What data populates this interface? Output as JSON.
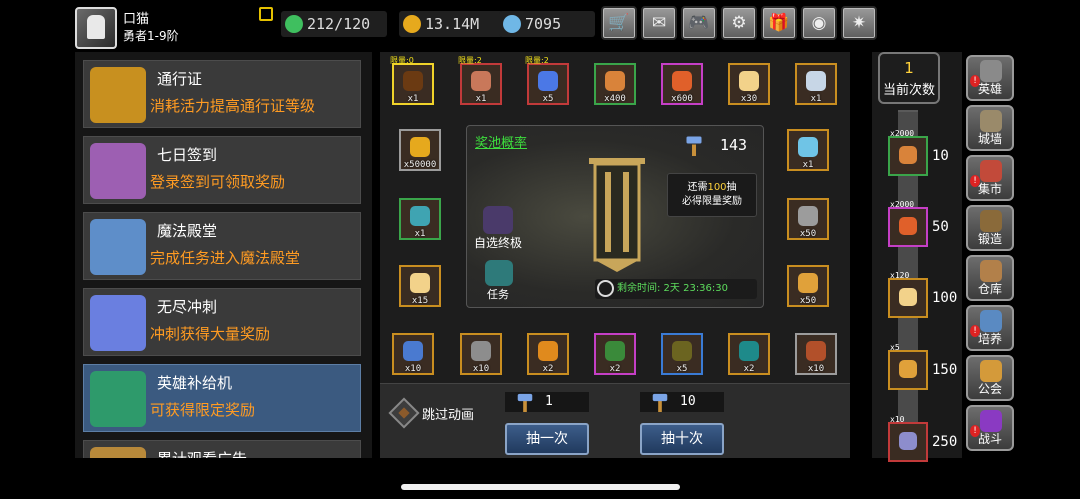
{
  "player": {
    "name": "口猫",
    "rank": "勇者1-9阶"
  },
  "resources": [
    {
      "name": "stamina",
      "icon": "lightning-icon",
      "value": "212/120",
      "color": "#3fbf5f"
    },
    {
      "name": "gold",
      "icon": "gold-coin-icon",
      "value": "13.14M",
      "color": "#e6a91d"
    },
    {
      "name": "diamond",
      "icon": "diamond-icon",
      "value": "7095",
      "color": "#6fb7e6"
    }
  ],
  "top_buttons": [
    {
      "name": "shop-button",
      "icon": "cart-icon",
      "glyph": "🛒"
    },
    {
      "name": "mail-button",
      "icon": "mail-icon",
      "glyph": "✉"
    },
    {
      "name": "gamepad-button",
      "icon": "gamepad-icon",
      "glyph": "🎮"
    },
    {
      "name": "settings-button",
      "icon": "gear-icon",
      "glyph": "⚙"
    },
    {
      "name": "gift-button",
      "icon": "gift-icon",
      "glyph": "🎁"
    },
    {
      "name": "color-wheel-button",
      "icon": "color-wheel-icon",
      "glyph": "◉"
    },
    {
      "name": "effects-button",
      "icon": "sparkle-icon",
      "glyph": "✷"
    }
  ],
  "left_menu": [
    {
      "title": "通行证",
      "desc": "消耗活力提高通行证等级",
      "icon": "golden-chalice-icon",
      "color": "#c8901f"
    },
    {
      "title": "七日签到",
      "desc": "登录签到可领取奖励",
      "icon": "treasure-chest-icon",
      "color": "#9d5fb2"
    },
    {
      "title": "魔法殿堂",
      "desc": "完成任务进入魔法殿堂",
      "icon": "ice-crystal-icon",
      "color": "#5e8ec9"
    },
    {
      "title": "无尽冲刺",
      "desc": "冲刺获得大量奖励",
      "icon": "blue-flame-icon",
      "color": "#6a7fe0"
    },
    {
      "title": "英雄补给机",
      "desc": "可获得限定奖励",
      "icon": "green-machine-icon",
      "color": "#2e9a6b"
    },
    {
      "title": "累计观看广告",
      "desc": "",
      "icon": "tv-icon",
      "color": "#b8893a"
    }
  ],
  "prize_pool": {
    "title": "奖池概率",
    "hammer_count": "143",
    "tip_prefix": "还需",
    "tip_number": "100",
    "tip_suffix": "抽",
    "tip_line2": "必得限量奖励",
    "boss_label": "自选终极",
    "task_label": "任务",
    "timer_text": "剩余时间: 2天 23:36:30"
  },
  "grid_items": [
    {
      "name": "totem",
      "count": "x1",
      "limit": "限量:0",
      "border": "b-yellow",
      "color": "#6b3a12"
    },
    {
      "name": "scroll",
      "count": "x1",
      "limit": "限量:2",
      "border": "b-red",
      "color": "#c9785a"
    },
    {
      "name": "blue-star",
      "count": "x5",
      "limit": "限量:2",
      "border": "b-red",
      "color": "#4b78e6"
    },
    {
      "name": "bone",
      "count": "x400",
      "limit": "",
      "border": "b-green",
      "color": "#d9833a"
    },
    {
      "name": "flame-ore",
      "count": "x600",
      "limit": "",
      "border": "b-pink",
      "color": "#e0602a"
    },
    {
      "name": "egg",
      "count": "x30",
      "limit": "",
      "border": "b-gold",
      "color": "#f2d28a"
    },
    {
      "name": "feather",
      "count": "x1",
      "limit": "",
      "border": "b-gold",
      "color": "#c7d6e6"
    },
    {
      "name": "gold-coin",
      "count": "x50000",
      "limit": "",
      "border": "b-gray",
      "color": "#e6a91d"
    },
    {
      "name": "sapphire",
      "count": "x1",
      "limit": "",
      "border": "b-gold",
      "color": "#6fc4e6"
    },
    {
      "name": "chest",
      "count": "x1",
      "limit": "",
      "border": "b-green",
      "color": "#3fa4b2"
    },
    {
      "name": "hammer",
      "count": "x50",
      "limit": "",
      "border": "b-gold",
      "color": "#9c9c9c"
    },
    {
      "name": "golden-egg",
      "count": "x15",
      "limit": "",
      "border": "b-gold",
      "color": "#f2d28a"
    },
    {
      "name": "wand",
      "count": "x50",
      "limit": "",
      "border": "b-gold",
      "color": "#e0a13a"
    },
    {
      "name": "blue-ore",
      "count": "x10",
      "limit": "",
      "border": "b-gold",
      "color": "#4a7ad0"
    },
    {
      "name": "war-hammer",
      "count": "x10",
      "limit": "",
      "border": "b-gold",
      "color": "#8d8d8d"
    },
    {
      "name": "orange-gem",
      "count": "x2",
      "limit": "",
      "border": "b-gold",
      "color": "#e08a1d"
    },
    {
      "name": "green-rune",
      "count": "x2",
      "limit": "",
      "border": "b-pink",
      "color": "#3a8a3a"
    },
    {
      "name": "dark-rune",
      "count": "x5",
      "limit": "",
      "border": "b-blue",
      "color": "#6b6420"
    },
    {
      "name": "teal-book",
      "count": "x2",
      "limit": "",
      "border": "b-gold",
      "color": "#1e8a8a"
    },
    {
      "name": "red-book",
      "count": "x10",
      "limit": "",
      "border": "b-gray",
      "color": "#b2502a"
    }
  ],
  "bottom": {
    "skip_label": "跳过动画",
    "single_cost": "1",
    "ten_cost": "10",
    "single_label": "抽一次",
    "ten_label": "抽十次"
  },
  "progress": {
    "current": "1",
    "current_label": "当前次数",
    "milestones": [
      {
        "count": "x2000",
        "value": "10",
        "color": "#d9833a",
        "border": "#3aa54a"
      },
      {
        "count": "x2000",
        "value": "50",
        "color": "#e0602a",
        "border": "#c53fc6"
      },
      {
        "count": "x120",
        "value": "100",
        "color": "#f2d28a",
        "border": "#c98e20"
      },
      {
        "count": "x5",
        "value": "150",
        "color": "#e0a13a",
        "border": "#c98e20"
      },
      {
        "count": "x10",
        "value": "250",
        "color": "#8d8dcc",
        "border": "#c23a3a"
      }
    ]
  },
  "right_nav": [
    {
      "label": "英雄",
      "icon": "knight-helmet-icon",
      "color": "#8a8a8a",
      "alert": true
    },
    {
      "label": "城墙",
      "icon": "castle-wall-icon",
      "color": "#9a8a6a",
      "alert": false
    },
    {
      "label": "集市",
      "icon": "market-icon",
      "color": "#c24a3a",
      "alert": true
    },
    {
      "label": "锻造",
      "icon": "anvil-icon",
      "color": "#8a6a3a",
      "alert": false
    },
    {
      "label": "仓库",
      "icon": "warehouse-icon",
      "color": "#b2804a",
      "alert": false
    },
    {
      "label": "培养",
      "icon": "flask-icon",
      "color": "#5a8ac2",
      "alert": true
    },
    {
      "label": "公会",
      "icon": "guild-icon",
      "color": "#d49a3a",
      "alert": false
    },
    {
      "label": "战斗",
      "icon": "portal-icon",
      "color": "#8a3ac2",
      "alert": true
    }
  ]
}
